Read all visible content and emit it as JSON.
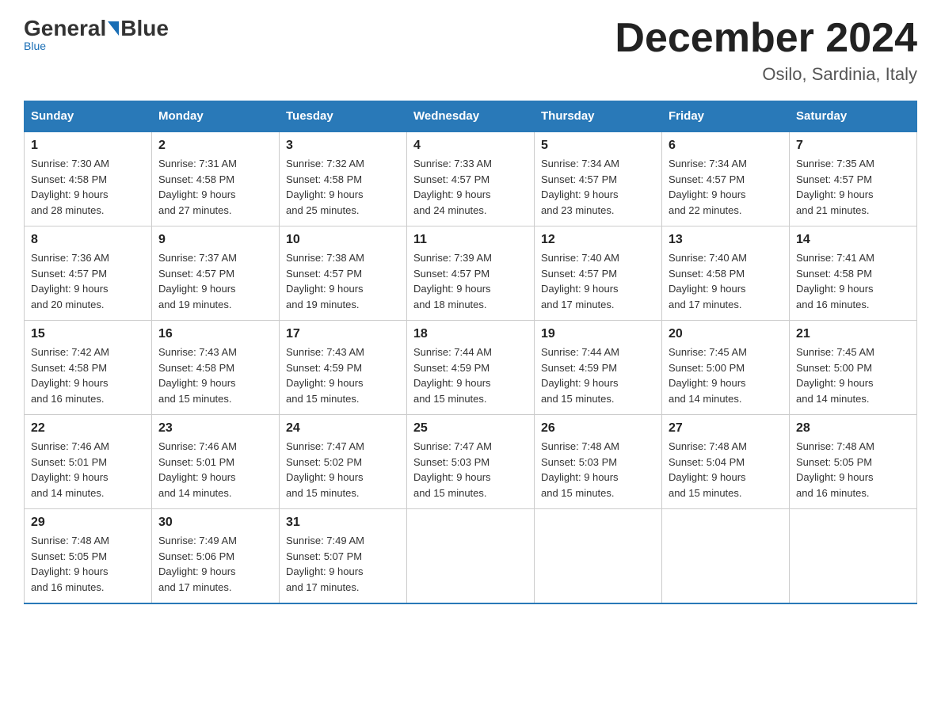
{
  "logo": {
    "general": "General",
    "blue": "Blue",
    "underline": "Blue"
  },
  "header": {
    "month_year": "December 2024",
    "location": "Osilo, Sardinia, Italy"
  },
  "days_of_week": [
    "Sunday",
    "Monday",
    "Tuesday",
    "Wednesday",
    "Thursday",
    "Friday",
    "Saturday"
  ],
  "weeks": [
    [
      {
        "day": "1",
        "sunrise": "7:30 AM",
        "sunset": "4:58 PM",
        "daylight": "9 hours and 28 minutes."
      },
      {
        "day": "2",
        "sunrise": "7:31 AM",
        "sunset": "4:58 PM",
        "daylight": "9 hours and 27 minutes."
      },
      {
        "day": "3",
        "sunrise": "7:32 AM",
        "sunset": "4:58 PM",
        "daylight": "9 hours and 25 minutes."
      },
      {
        "day": "4",
        "sunrise": "7:33 AM",
        "sunset": "4:57 PM",
        "daylight": "9 hours and 24 minutes."
      },
      {
        "day": "5",
        "sunrise": "7:34 AM",
        "sunset": "4:57 PM",
        "daylight": "9 hours and 23 minutes."
      },
      {
        "day": "6",
        "sunrise": "7:34 AM",
        "sunset": "4:57 PM",
        "daylight": "9 hours and 22 minutes."
      },
      {
        "day": "7",
        "sunrise": "7:35 AM",
        "sunset": "4:57 PM",
        "daylight": "9 hours and 21 minutes."
      }
    ],
    [
      {
        "day": "8",
        "sunrise": "7:36 AM",
        "sunset": "4:57 PM",
        "daylight": "9 hours and 20 minutes."
      },
      {
        "day": "9",
        "sunrise": "7:37 AM",
        "sunset": "4:57 PM",
        "daylight": "9 hours and 19 minutes."
      },
      {
        "day": "10",
        "sunrise": "7:38 AM",
        "sunset": "4:57 PM",
        "daylight": "9 hours and 19 minutes."
      },
      {
        "day": "11",
        "sunrise": "7:39 AM",
        "sunset": "4:57 PM",
        "daylight": "9 hours and 18 minutes."
      },
      {
        "day": "12",
        "sunrise": "7:40 AM",
        "sunset": "4:57 PM",
        "daylight": "9 hours and 17 minutes."
      },
      {
        "day": "13",
        "sunrise": "7:40 AM",
        "sunset": "4:58 PM",
        "daylight": "9 hours and 17 minutes."
      },
      {
        "day": "14",
        "sunrise": "7:41 AM",
        "sunset": "4:58 PM",
        "daylight": "9 hours and 16 minutes."
      }
    ],
    [
      {
        "day": "15",
        "sunrise": "7:42 AM",
        "sunset": "4:58 PM",
        "daylight": "9 hours and 16 minutes."
      },
      {
        "day": "16",
        "sunrise": "7:43 AM",
        "sunset": "4:58 PM",
        "daylight": "9 hours and 15 minutes."
      },
      {
        "day": "17",
        "sunrise": "7:43 AM",
        "sunset": "4:59 PM",
        "daylight": "9 hours and 15 minutes."
      },
      {
        "day": "18",
        "sunrise": "7:44 AM",
        "sunset": "4:59 PM",
        "daylight": "9 hours and 15 minutes."
      },
      {
        "day": "19",
        "sunrise": "7:44 AM",
        "sunset": "4:59 PM",
        "daylight": "9 hours and 15 minutes."
      },
      {
        "day": "20",
        "sunrise": "7:45 AM",
        "sunset": "5:00 PM",
        "daylight": "9 hours and 14 minutes."
      },
      {
        "day": "21",
        "sunrise": "7:45 AM",
        "sunset": "5:00 PM",
        "daylight": "9 hours and 14 minutes."
      }
    ],
    [
      {
        "day": "22",
        "sunrise": "7:46 AM",
        "sunset": "5:01 PM",
        "daylight": "9 hours and 14 minutes."
      },
      {
        "day": "23",
        "sunrise": "7:46 AM",
        "sunset": "5:01 PM",
        "daylight": "9 hours and 14 minutes."
      },
      {
        "day": "24",
        "sunrise": "7:47 AM",
        "sunset": "5:02 PM",
        "daylight": "9 hours and 15 minutes."
      },
      {
        "day": "25",
        "sunrise": "7:47 AM",
        "sunset": "5:03 PM",
        "daylight": "9 hours and 15 minutes."
      },
      {
        "day": "26",
        "sunrise": "7:48 AM",
        "sunset": "5:03 PM",
        "daylight": "9 hours and 15 minutes."
      },
      {
        "day": "27",
        "sunrise": "7:48 AM",
        "sunset": "5:04 PM",
        "daylight": "9 hours and 15 minutes."
      },
      {
        "day": "28",
        "sunrise": "7:48 AM",
        "sunset": "5:05 PM",
        "daylight": "9 hours and 16 minutes."
      }
    ],
    [
      {
        "day": "29",
        "sunrise": "7:48 AM",
        "sunset": "5:05 PM",
        "daylight": "9 hours and 16 minutes."
      },
      {
        "day": "30",
        "sunrise": "7:49 AM",
        "sunset": "5:06 PM",
        "daylight": "9 hours and 17 minutes."
      },
      {
        "day": "31",
        "sunrise": "7:49 AM",
        "sunset": "5:07 PM",
        "daylight": "9 hours and 17 minutes."
      },
      null,
      null,
      null,
      null
    ]
  ],
  "labels": {
    "sunrise": "Sunrise:",
    "sunset": "Sunset:",
    "daylight": "Daylight:"
  }
}
